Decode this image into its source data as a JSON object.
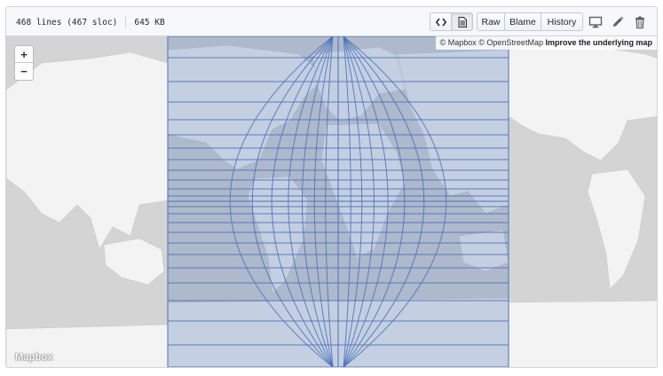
{
  "file_info": {
    "lines": "468 lines (467 sloc)",
    "size": "645 KB"
  },
  "toolbar": {
    "raw_label": "Raw",
    "blame_label": "Blame",
    "history_label": "History",
    "code_icon": "code-icon",
    "render_icon": "file-icon",
    "desktop_icon": "desktop-icon",
    "edit_icon": "pencil-icon",
    "delete_icon": "trash-icon"
  },
  "map": {
    "zoom_in": "+",
    "zoom_out": "−",
    "attribution_mapbox": "© Mapbox",
    "attribution_osm": "© OpenStreetMap",
    "attribution_improve": "Improve the underlying map",
    "logo": "Mapbox",
    "overlay_color": "#4a72b8"
  }
}
